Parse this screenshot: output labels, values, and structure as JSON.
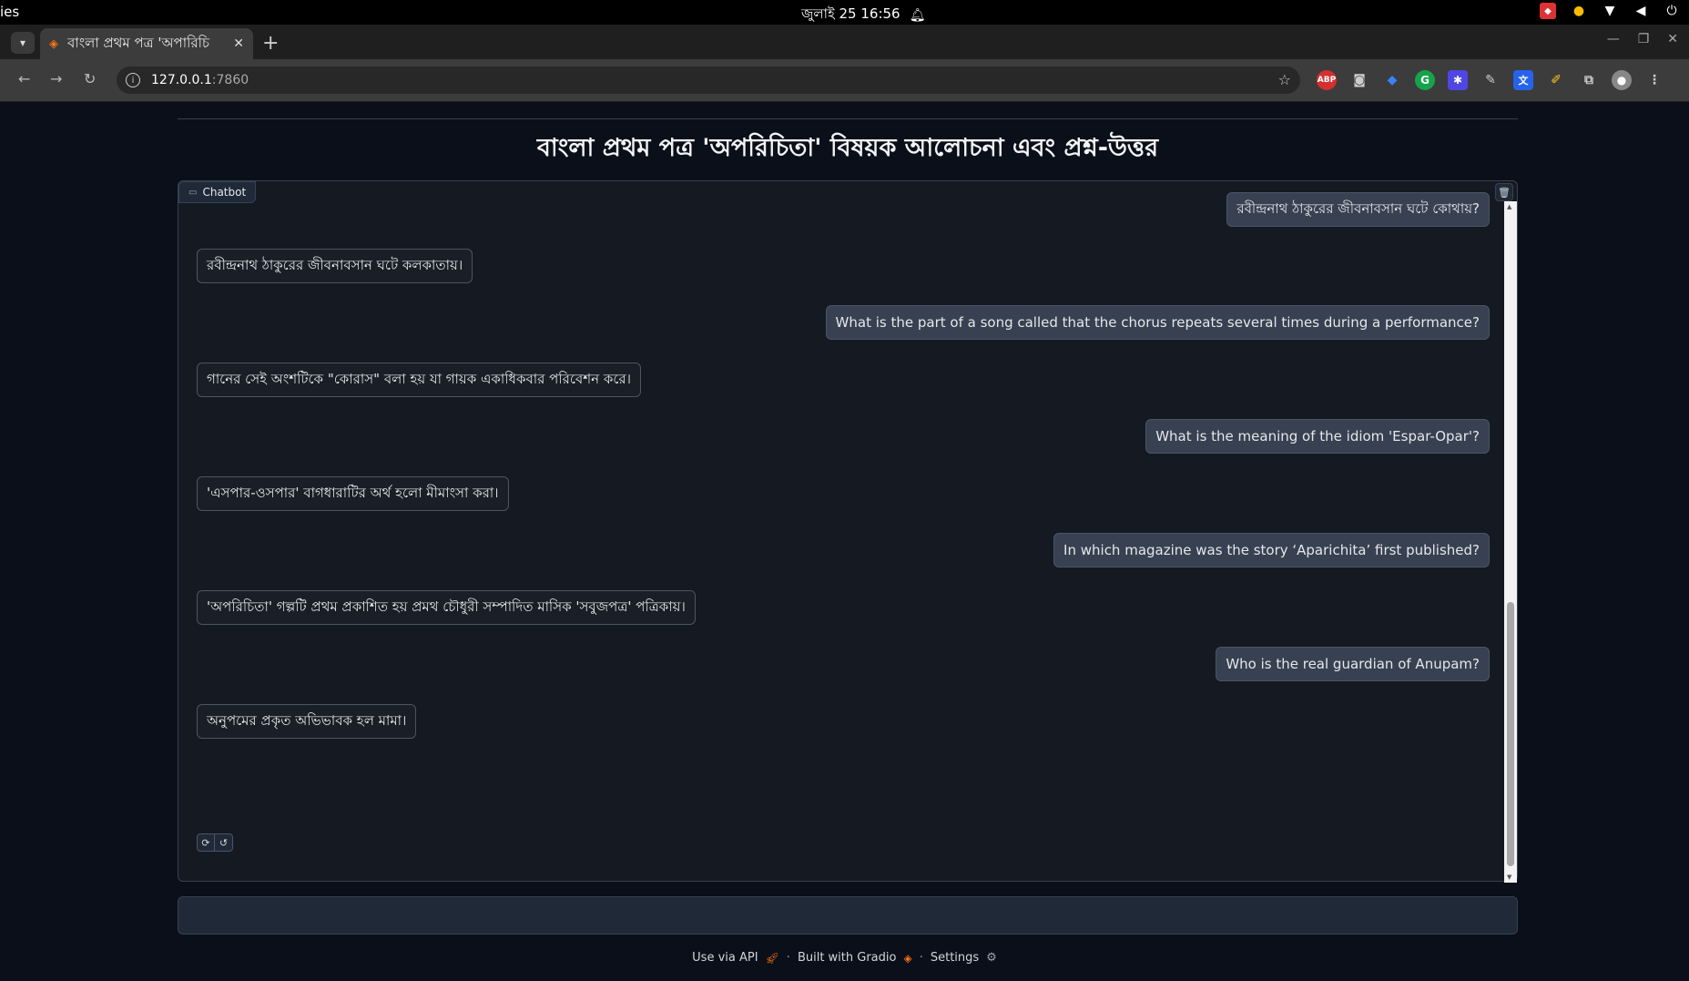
{
  "os": {
    "left_text": "ies",
    "datetime": "জুলাই 25  16:56"
  },
  "browser": {
    "tab_title": "বাংলা প্রথম পত্র 'অপারিচি",
    "url_host": "127.0.0.1",
    "url_port": ":7860"
  },
  "page": {
    "title": "বাংলা প্রথম পত্র 'অপরিচিতা' বিষয়ক আলোচনা এবং প্রশ্ন-উত্তর"
  },
  "chatbot": {
    "label": "Chatbot",
    "messages": [
      {
        "role": "user",
        "text": "রবীন্দ্রনাথ ঠাকুরের জীবনাবসান ঘটে কোথায়?"
      },
      {
        "role": "bot",
        "text": "রবীন্দ্রনাথ ঠাকুরের জীবনাবসান ঘটে কলকাতায়।"
      },
      {
        "role": "user",
        "text": "What is the part of a song called that the chorus repeats several times during a performance?"
      },
      {
        "role": "bot",
        "text": "গানের সেই অংশটিকে \"কোরাস\" বলা হয় যা গায়ক একাধিকবার পরিবেশন করে।"
      },
      {
        "role": "user",
        "text": "What is the meaning of the idiom 'Espar-Opar'?"
      },
      {
        "role": "bot",
        "text": "'এসপার-ওসপার' বাগধারাটির অর্থ হলো মীমাংসা করা।"
      },
      {
        "role": "user",
        "text": "In which magazine was the story ‘Aparichita’ first published?"
      },
      {
        "role": "bot",
        "text": "'অপরিচিতা' গল্পটি প্রথম প্রকাশিত হয় প্রমথ চৌধুরী সম্পাদিত মাসিক 'সবুজপত্র' পত্রিকায়।"
      },
      {
        "role": "user",
        "text": "Who is the real guardian of Anupam?"
      },
      {
        "role": "bot",
        "text": "অনুপমের প্রকৃত অভিভাবক হল মামা।"
      }
    ]
  },
  "footer": {
    "api": "Use via API",
    "built": "Built with Gradio",
    "settings": "Settings"
  }
}
